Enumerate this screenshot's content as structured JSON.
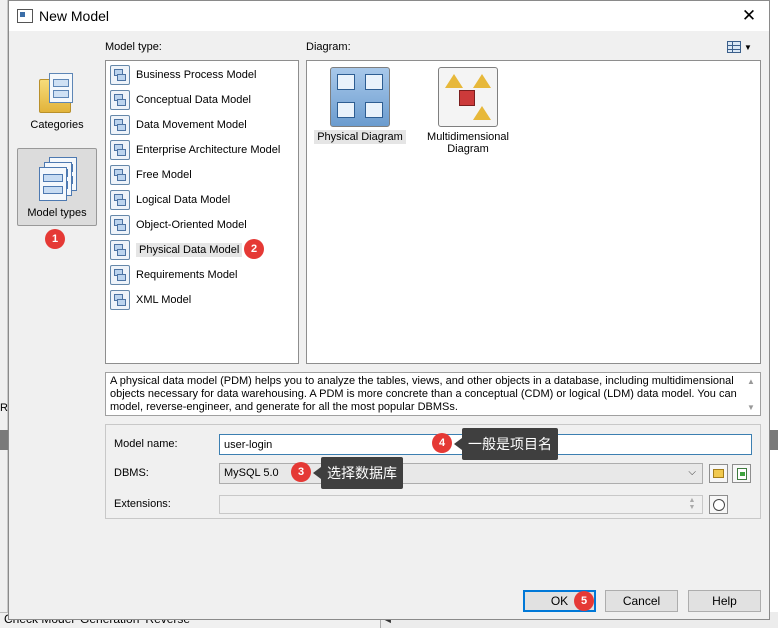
{
  "dialog": {
    "title": "New Model",
    "model_type_label": "Model type:",
    "diagram_label": "Diagram:"
  },
  "categories": [
    {
      "label": "Categories",
      "icon": "folder-icon",
      "selected": false
    },
    {
      "label": "Model types",
      "icon": "model-types-icon",
      "selected": true
    }
  ],
  "model_types": [
    {
      "label": "Business Process Model",
      "icon": "business-process-model-icon"
    },
    {
      "label": "Conceptual Data Model",
      "icon": "conceptual-data-model-icon"
    },
    {
      "label": "Data Movement Model",
      "icon": "data-movement-model-icon"
    },
    {
      "label": "Enterprise Architecture Model",
      "icon": "enterprise-architecture-model-icon"
    },
    {
      "label": "Free Model",
      "icon": "free-model-icon"
    },
    {
      "label": "Logical Data Model",
      "icon": "logical-data-model-icon"
    },
    {
      "label": "Object-Oriented Model",
      "icon": "object-oriented-model-icon"
    },
    {
      "label": "Physical Data Model",
      "icon": "physical-data-model-icon",
      "selected": true
    },
    {
      "label": "Requirements Model",
      "icon": "requirements-model-icon"
    },
    {
      "label": "XML Model",
      "icon": "xml-model-icon"
    }
  ],
  "diagrams": [
    {
      "label": "Physical Diagram",
      "icon": "physical-diagram-icon",
      "selected": true
    },
    {
      "label": "Multidimensional Diagram",
      "icon": "multidimensional-diagram-icon"
    }
  ],
  "description": "A physical data model (PDM) helps you to analyze the tables, views, and other objects in a database, including multidimensional objects necessary for data warehousing. A PDM is more concrete than a conceptual (CDM) or logical (LDM) data model. You can model, reverse-engineer, and generate for all the most popular DBMSs.",
  "form": {
    "model_name_label": "Model name:",
    "model_name_value": "user-login",
    "dbms_label": "DBMS:",
    "dbms_value": "MySQL 5.0",
    "extensions_label": "Extensions:",
    "extensions_value": ""
  },
  "annotations": [
    {
      "number": "1"
    },
    {
      "number": "2"
    },
    {
      "number": "3",
      "text": "选择数据库"
    },
    {
      "number": "4",
      "text": "一般是项目名"
    },
    {
      "number": "5"
    }
  ],
  "buttons": {
    "ok": "OK",
    "cancel": "Cancel",
    "help": "Help"
  },
  "background": {
    "tabs": [
      "Check Model",
      "Generation",
      "Reverse"
    ],
    "marker": "R"
  },
  "colors": {
    "accent": "#0078d7",
    "badge": "#e53935",
    "callout": "#3f3f3f"
  }
}
